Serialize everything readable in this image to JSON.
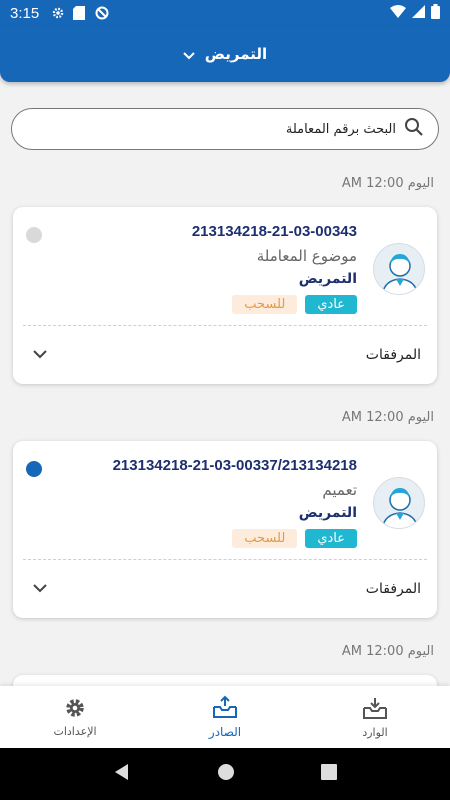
{
  "status_bar": {
    "time": "3:15"
  },
  "header": {
    "title": "التمريض"
  },
  "search": {
    "placeholder": "البحث برقم المعاملة"
  },
  "items": [
    {
      "date": "اليوم 12:00 AM",
      "ref": "213134218-21-03-00343",
      "subject": "موضوع المعاملة",
      "department": "التمريض",
      "priority": "عادي",
      "status": "للسحب",
      "read_dot_color": "#d9d9d9",
      "attachments_label": "المرفقات"
    },
    {
      "date": "اليوم 12:00 AM",
      "ref": "213134218-21-03-00337/213134218",
      "subject": "تعميم",
      "department": "التمريض",
      "priority": "عادي",
      "status": "للسحب",
      "read_dot_color": "#1767b8",
      "attachments_label": "المرفقات"
    },
    {
      "date": "اليوم 12:00 AM"
    }
  ],
  "bottom_nav": [
    {
      "label": "الوارد",
      "icon": "inbox-icon"
    },
    {
      "label": "الصادر",
      "icon": "outbox-icon",
      "active": true
    },
    {
      "label": "الإعدادات",
      "icon": "gear-icon"
    }
  ],
  "colors": {
    "primary": "#1767b8",
    "badge_normal": "#1fb8d0",
    "badge_withdraw_bg": "#fdecdc",
    "badge_withdraw_text": "#e59a4a",
    "navy_text": "#1d2f6f"
  }
}
